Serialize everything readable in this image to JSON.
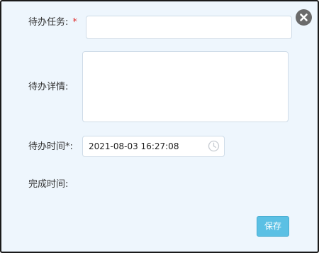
{
  "form": {
    "task_label": "待办任务:",
    "task_required_mark": "*",
    "task_value": "",
    "detail_label": "待办详情:",
    "detail_value": "",
    "time_label": "待办时间*:",
    "time_value": "2021-08-03 16:27:08",
    "done_label": "完成时间:"
  },
  "actions": {
    "save_label": "保存"
  },
  "icons": {
    "close": "close-circle-icon",
    "time": "clock-icon"
  },
  "colors": {
    "background": "#eef6fd",
    "required": "#e03030",
    "save_button": "#5bc0e4",
    "close_button": "#6b6b6b"
  }
}
